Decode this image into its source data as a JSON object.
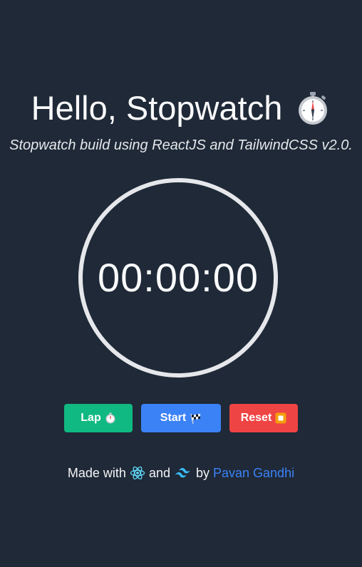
{
  "header": {
    "title": "Hello, Stopwatch",
    "title_icon": "stopwatch-icon",
    "subtitle": "Stopwatch build using ReactJS and TailwindCSS v2.0."
  },
  "timer": {
    "display": "00:00:00"
  },
  "controls": {
    "lap_label": "Lap",
    "lap_icon": "stopwatch-icon",
    "lap_color": "#10b981",
    "start_label": "Start",
    "start_icon": "checkered-flag-icon",
    "start_color": "#3b82f6",
    "reset_label": "Reset",
    "reset_icon": "stop-square-icon",
    "reset_color": "#ef4444"
  },
  "footer": {
    "made_with": "Made with",
    "and": "and",
    "by": "by",
    "author": "Pavan Gandhi",
    "react_icon": "react-logo-icon",
    "tailwind_icon": "tailwind-logo-icon",
    "author_color": "#3b82f6"
  },
  "theme": {
    "background": "#1f2937",
    "ring": "#e5e7eb"
  }
}
